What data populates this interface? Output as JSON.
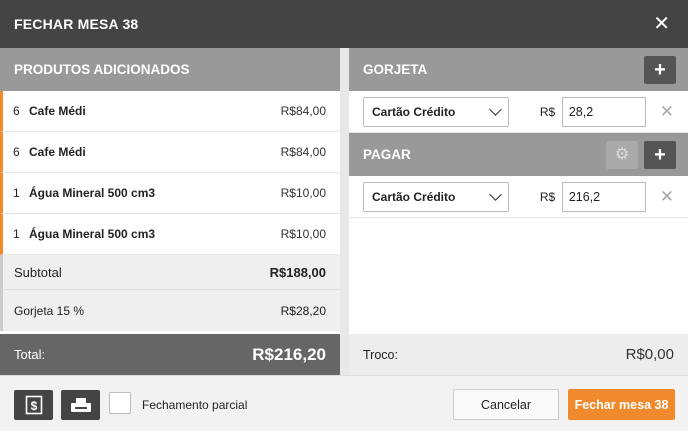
{
  "header": {
    "title": "FECHAR MESA 38",
    "close_icon": "close-icon"
  },
  "products": {
    "heading": "PRODUTOS ADICIONADOS",
    "items": [
      {
        "qty": "6",
        "name": "Cafe Médi",
        "price": "R$84,00"
      },
      {
        "qty": "6",
        "name": "Cafe Médi",
        "price": "R$84,00"
      },
      {
        "qty": "1",
        "name": "Água Mineral 500 cm3",
        "price": "R$10,00"
      },
      {
        "qty": "1",
        "name": "Água Mineral 500 cm3",
        "price": "R$10,00"
      }
    ],
    "subtotal_label": "Subtotal",
    "subtotal_value": "R$188,00",
    "tip_label": "Gorjeta 15 %",
    "tip_value": "R$28,20",
    "total_label": "Total:",
    "total_value": "R$216,20"
  },
  "tip_section": {
    "heading": "GORJETA",
    "add_label": "+",
    "method": "Cartão Crédito",
    "currency": "R$",
    "amount": "28,2",
    "remove_label": "✕"
  },
  "pay_section": {
    "heading": "PAGAR",
    "add_label": "+",
    "gear_label": "⚙",
    "method": "Cartão Crédito",
    "currency": "R$",
    "amount": "216,2",
    "remove_label": "✕"
  },
  "change": {
    "label": "Troco:",
    "value": "R$0,00"
  },
  "footer": {
    "partial_label": "Fechamento parcial",
    "cancel_label": "Cancelar",
    "confirm_label": "Fechar mesa 38"
  },
  "colors": {
    "accent": "#f08a2c",
    "header": "#444444",
    "section": "#999999"
  }
}
